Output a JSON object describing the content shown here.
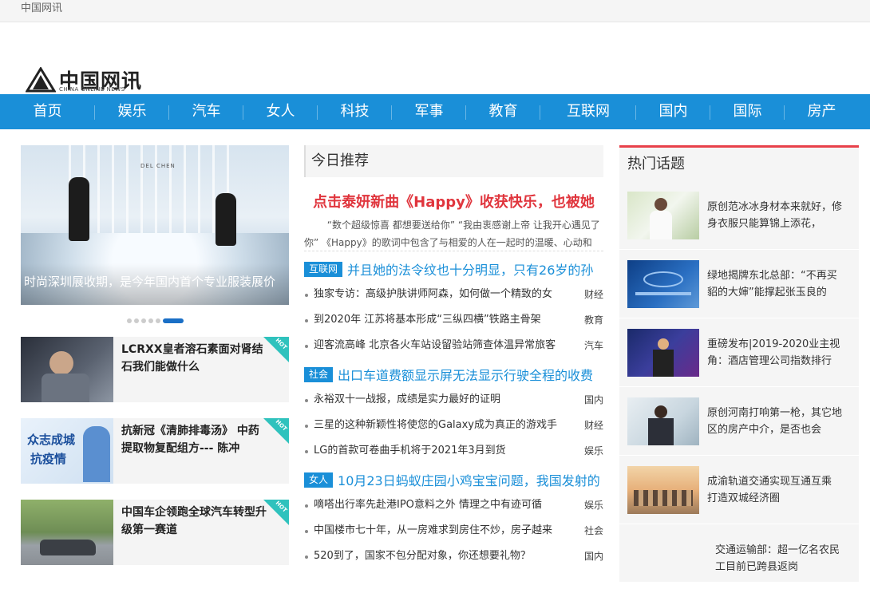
{
  "topbar": {
    "site_name": "中国网讯"
  },
  "logo": {
    "main": "中国网讯",
    "sub": "CHINA ONLINE NEWS"
  },
  "nav": [
    "首页",
    "娱乐",
    "汽车",
    "女人",
    "科技",
    "军事",
    "教育",
    "互联网",
    "国内",
    "国际",
    "房产"
  ],
  "slider": {
    "brand": "DEL CHEN",
    "caption": "时尚深圳展收期，是今年国内首个专业服装展价",
    "dot_count": 5,
    "active_dot": 6
  },
  "hot_badge": "HOT",
  "hot_news": [
    {
      "title": "LCRXX皇者溶石素面对肾结石我们能做什么"
    },
    {
      "title": "抗新冠《清肺排毒汤》 中药提取物复配组方--- 陈冲",
      "thumb_text_1": "众志成城",
      "thumb_text_2": "抗疫情"
    },
    {
      "title": "中国车企领跑全球汽车转型升级第一赛道"
    }
  ],
  "recommend": {
    "section_title": "今日推荐",
    "headline": "点击泰妍新曲《Happy》收获快乐，也被她",
    "summary": "“数个超级惊喜 都想要送给你” “我由衷感谢上帝 让我开心遇见了你” 《Happy》的歌词中包含了与相爱的人在一起时的温暖、心动和",
    "categories": [
      {
        "tag": "互联网",
        "title": "并且她的法令纹也十分明显，只有26岁的孙",
        "items": [
          {
            "title": "独家专访：高级护肤讲师阿森，如何做一个精致的女",
            "cat": "财经"
          },
          {
            "title": "到2020年 江苏将基本形成“三纵四横”铁路主骨架",
            "cat": "教育"
          },
          {
            "title": "迎客流高峰 北京各火车站设留验站筛查体温异常旅客",
            "cat": "汽车"
          }
        ]
      },
      {
        "tag": "社会",
        "title": "出口车道费额显示屏无法显示行驶全程的收费",
        "items": [
          {
            "title": "永裕双十一战报，成绩是实力最好的证明",
            "cat": "国内"
          },
          {
            "title": "三星的这种新颖性将使您的Galaxy成为真正的游戏手",
            "cat": "财经"
          },
          {
            "title": "LG的首款可卷曲手机将于2021年3月到货",
            "cat": "娱乐"
          }
        ]
      },
      {
        "tag": "女人",
        "title": "10月23日蚂蚁庄园小鸡宝宝问题，我国发射的",
        "items": [
          {
            "title": "嘀嗒出行率先赴港IPO意料之外 情理之中有迹可循",
            "cat": "娱乐"
          },
          {
            "title": "中国楼市七十年，从一房难求到房住不炒，房子越来",
            "cat": "社会"
          },
          {
            "title": "520到了，国家不包分配对象，你还想要礼物？",
            "cat": "国内"
          }
        ]
      }
    ]
  },
  "hot_topics": {
    "section_title": "热门话题",
    "items": [
      {
        "title": "原创范冰冰身材本来就好，修身衣服只能算锦上添花，",
        "has_thumb": true
      },
      {
        "title": "绿地揭牌东北总部：“不再买貂的大婶”能撑起张玉良的",
        "has_thumb": true
      },
      {
        "title": "重磅发布|2019-2020业主视角：酒店管理公司指数排行",
        "has_thumb": true
      },
      {
        "title": "原创河南打响第一枪，其它地区的房产中介，是否也会",
        "has_thumb": true
      },
      {
        "title": "成渝轨道交通实现互通互乘 打造双城经济圈",
        "has_thumb": true
      },
      {
        "title": "交通运输部：超一亿名农民工目前已跨县返岗",
        "has_thumb": false
      }
    ]
  }
}
